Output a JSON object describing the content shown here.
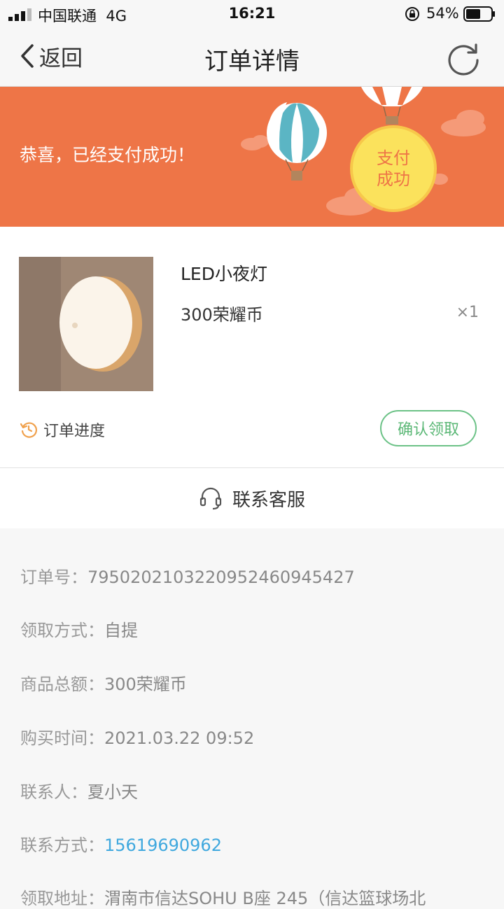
{
  "status_bar": {
    "carrier": "中国联通",
    "network": "4G",
    "time": "16:21",
    "battery": "54%"
  },
  "nav": {
    "back_label": "返回",
    "title": "订单详情"
  },
  "banner": {
    "message": "恭喜，已经支付成功！",
    "badge_line1": "支付",
    "badge_line2": "成功",
    "color": "#ee7547"
  },
  "product": {
    "name": "LED小夜灯",
    "price": "300荣耀币",
    "quantity": "×1",
    "progress_label": "订单进度",
    "confirm_label": "确认领取"
  },
  "service": {
    "label": "联系客服"
  },
  "info": {
    "order_no_label": "订单号：",
    "order_no": "7950202103220952460945427",
    "pickup_label": "领取方式：",
    "pickup": "自提",
    "total_label": "商品总额：",
    "total": "300荣耀币",
    "time_label": "购买时间：",
    "time": "2021.03.22 09:52",
    "contact_label": "联系人：",
    "contact": "夏小天",
    "phone_label": "联系方式：",
    "phone": "15619690962",
    "address_label": "领取地址：",
    "address": "渭南市信达SOHU B座 245（信达篮球场北"
  }
}
